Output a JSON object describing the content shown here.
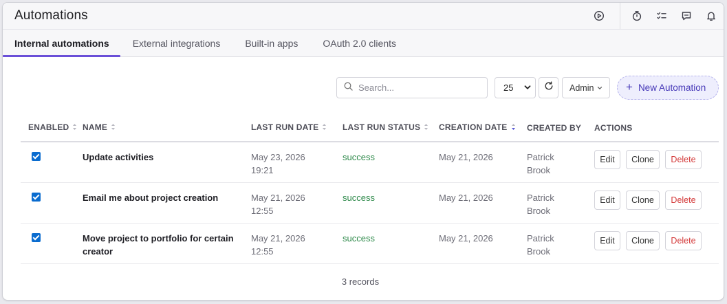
{
  "app": {
    "title": "Automations"
  },
  "topbar_icons": [
    "play-circle-icon",
    "stopwatch-icon",
    "checklist-icon",
    "chat-icon",
    "bell-icon"
  ],
  "tabs": [
    {
      "label": "Internal automations",
      "active": true
    },
    {
      "label": "External integrations",
      "active": false
    },
    {
      "label": "Built-in apps",
      "active": false
    },
    {
      "label": "OAuth 2.0 clients",
      "active": false
    }
  ],
  "toolbar": {
    "search_placeholder": "Search...",
    "per_page": "25",
    "admin_label": "Admin",
    "new_label": "New Automation"
  },
  "table": {
    "headers": {
      "enabled": "ENABLED",
      "name": "NAME",
      "last_run_date": "LAST RUN DATE",
      "last_run_status": "LAST RUN STATUS",
      "creation_date": "CREATION DATE",
      "created_by": "CREATED BY",
      "actions": "ACTIONS"
    },
    "rows": [
      {
        "enabled": true,
        "name": "Update activities",
        "last_run_date": "May 23, 2026",
        "last_run_time": "19:21",
        "status": "success",
        "creation_date": "May 21, 2026",
        "created_by_first": "Patrick",
        "created_by_last": "Brook"
      },
      {
        "enabled": true,
        "name": "Email me about project creation",
        "last_run_date": "May 21, 2026",
        "last_run_time": "12:55",
        "status": "success",
        "creation_date": "May 21, 2026",
        "created_by_first": "Patrick",
        "created_by_last": "Brook"
      },
      {
        "enabled": true,
        "name": "Move project to portfolio for certain creator",
        "last_run_date": "May 21, 2026",
        "last_run_time": "12:55",
        "status": "success",
        "creation_date": "May 21, 2026",
        "created_by_first": "Patrick",
        "created_by_last": "Brook"
      }
    ],
    "actions": {
      "edit": "Edit",
      "clone": "Clone",
      "delete": "Delete"
    }
  },
  "footer": {
    "records": "3 records"
  },
  "colors": {
    "accent": "#6a4fd8",
    "checkbox": "#0a6ccf",
    "success": "#2f8a4b",
    "danger": "#d43a3a",
    "new_button_bg": "#eeeefd"
  }
}
